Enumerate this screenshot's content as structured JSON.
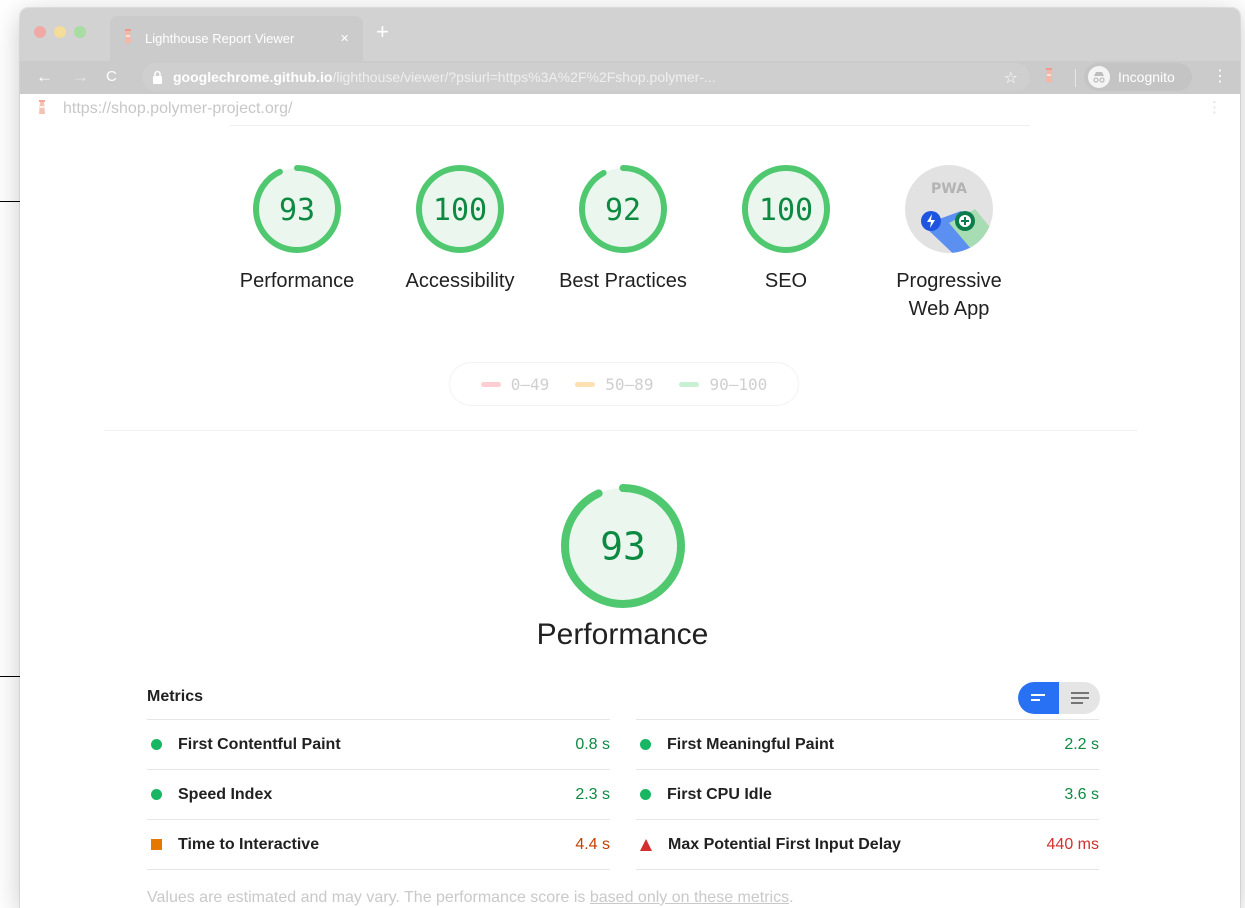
{
  "browser": {
    "tab_title": "Lighthouse Report Viewer",
    "tab_close": "×",
    "new_tab": "+",
    "url_host": "googlechrome.github.io",
    "url_path": "/lighthouse/viewer/?psiurl=https%3A%2F%2Fshop.polymer-...",
    "incognito_label": "Incognito",
    "back": "←",
    "forward": "→",
    "reload": "C",
    "star": "☆",
    "menu": "⋮"
  },
  "report": {
    "url": "https://shop.polymer-project.org/",
    "menu": "⋮"
  },
  "categories": [
    {
      "label": "Performance",
      "score": "93",
      "score_value": 93
    },
    {
      "label": "Accessibility",
      "score": "100",
      "score_value": 100
    },
    {
      "label": "Best Practices",
      "score": "92",
      "score_value": 92
    },
    {
      "label": "SEO",
      "score": "100",
      "score_value": 100
    }
  ],
  "pwa": {
    "badge": "PWA",
    "label_line1": "Progressive",
    "label_line2": "Web App"
  },
  "legend": [
    {
      "range": "0–49",
      "color": "#ffcdd2"
    },
    {
      "range": "50–89",
      "color": "#ffe0b2"
    },
    {
      "range": "90–100",
      "color": "#c8f0d5"
    }
  ],
  "performance": {
    "score": "93",
    "score_value": 93,
    "label": "Performance"
  },
  "metrics": {
    "title": "Metrics",
    "left": [
      {
        "name": "First Contentful Paint",
        "value": "0.8 s",
        "status": "pass"
      },
      {
        "name": "Speed Index",
        "value": "2.3 s",
        "status": "pass"
      },
      {
        "name": "Time to Interactive",
        "value": "4.4 s",
        "status": "average"
      }
    ],
    "right": [
      {
        "name": "First Meaningful Paint",
        "value": "2.2 s",
        "status": "pass"
      },
      {
        "name": "First CPU Idle",
        "value": "3.6 s",
        "status": "pass"
      },
      {
        "name": "Max Potential First Input Delay",
        "value": "440 ms",
        "status": "fail"
      }
    ],
    "footnote_text": "Values are estimated and may vary. The performance score is ",
    "footnote_link": "based only on these metrics",
    "footnote_end": "."
  },
  "colors": {
    "pass": "#0d8a42",
    "gauge_stroke": "#4fc870",
    "gauge_fill": "#ebf7ee",
    "average": "#e67700",
    "fail": "#d32f2f",
    "toggle_active": "#2870f4"
  }
}
